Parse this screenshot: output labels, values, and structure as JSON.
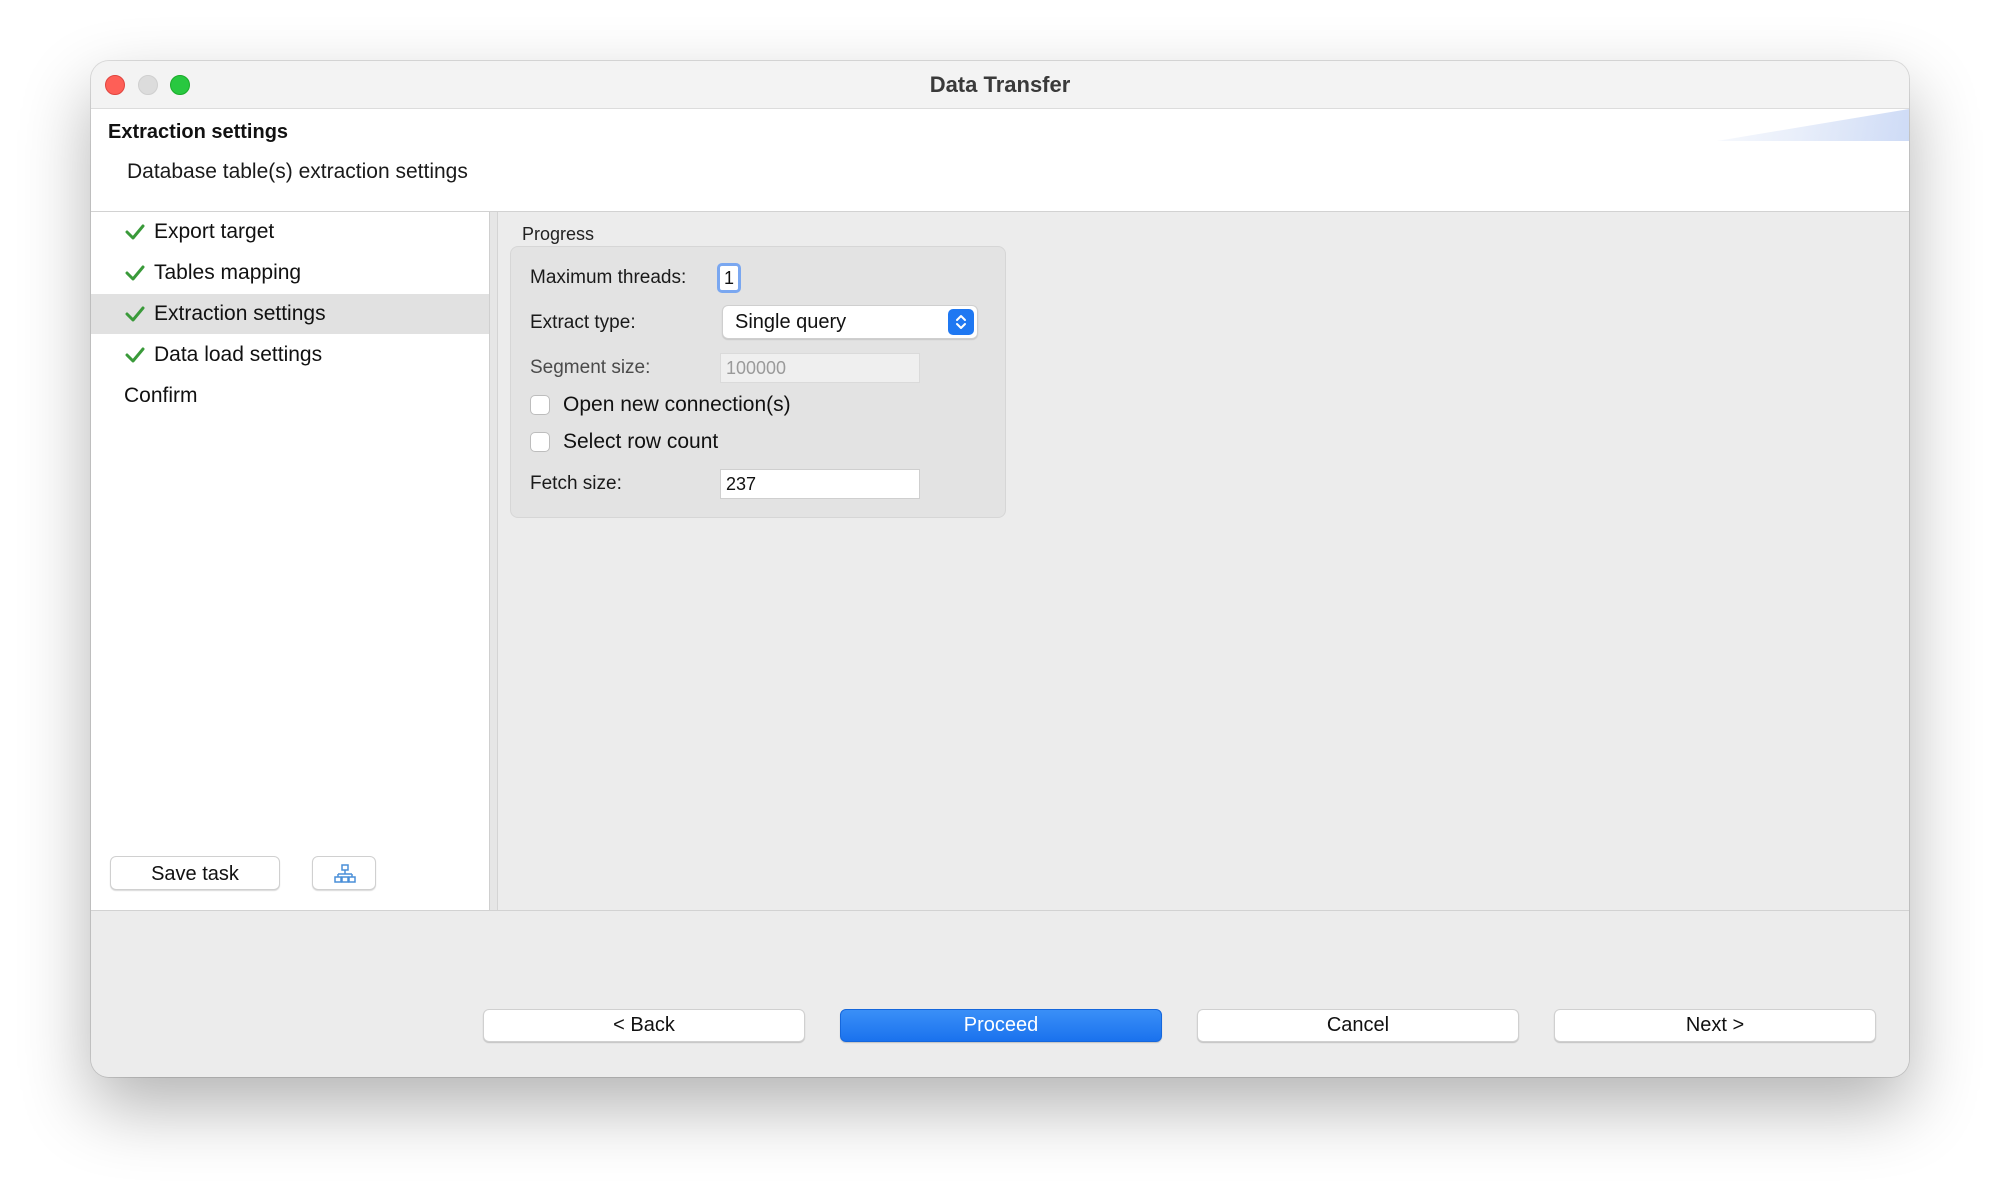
{
  "window": {
    "title": "Data Transfer"
  },
  "header": {
    "title": "Extraction settings",
    "subtitle": "Database table(s) extraction settings"
  },
  "sidebar": {
    "items": [
      {
        "label": "Export target",
        "done": true
      },
      {
        "label": "Tables mapping",
        "done": true
      },
      {
        "label": "Extraction settings",
        "done": true,
        "selected": true
      },
      {
        "label": "Data load settings",
        "done": true
      },
      {
        "label": "Confirm",
        "done": false
      }
    ],
    "save_task_label": "Save task",
    "schedule_icon": "schedule-task-icon"
  },
  "progress": {
    "group_label": "Progress",
    "max_threads_label": "Maximum threads:",
    "max_threads_value": "1",
    "extract_type_label": "Extract type:",
    "extract_type_value": "Single query",
    "segment_size_label": "Segment size:",
    "segment_size_placeholder": "100000",
    "open_new_connections_label": "Open new connection(s)",
    "select_row_count_label": "Select row count",
    "fetch_size_label": "Fetch size:",
    "fetch_size_value": "237"
  },
  "footer": {
    "back_label": "< Back",
    "proceed_label": "Proceed",
    "cancel_label": "Cancel",
    "next_label": "Next >"
  },
  "colors": {
    "accent": "#1a72ee",
    "check": "#3a9a3a",
    "close": "#fe5f57",
    "maximize": "#28c840"
  }
}
